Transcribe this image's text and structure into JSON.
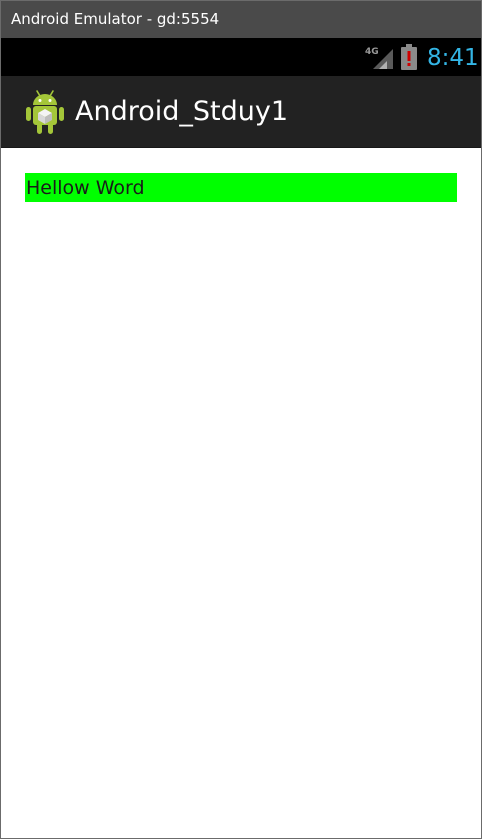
{
  "window": {
    "title": "Android Emulator - gd:5554"
  },
  "status_bar": {
    "network_label": "4G",
    "network_icon": "signal-4g-icon",
    "battery_icon": "battery-alert-icon",
    "time": "8:41",
    "time_color": "#33b5e5"
  },
  "action_bar": {
    "app_icon": "android-robot-icon",
    "title": "Android_Stduy1"
  },
  "content": {
    "hello_text": "Hellow Word",
    "hello_background": "#00ff00"
  }
}
